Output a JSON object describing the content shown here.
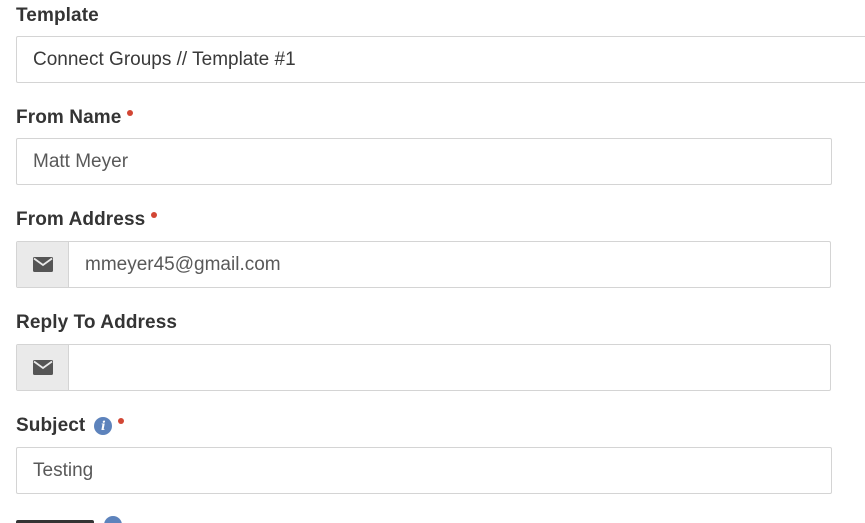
{
  "form": {
    "template": {
      "label": "Template",
      "value": "Connect Groups // Template #1"
    },
    "from_name": {
      "label": "From Name",
      "required": true,
      "value": "Matt Meyer"
    },
    "from_address": {
      "label": "From Address",
      "required": true,
      "icon": "envelope-icon",
      "value": "mmeyer45@gmail.com"
    },
    "reply_to_address": {
      "label": "Reply To Address",
      "icon": "envelope-icon",
      "value": ""
    },
    "subject": {
      "label": "Subject",
      "required": true,
      "info_icon": "info-icon",
      "value": "Testing"
    }
  },
  "colors": {
    "label_text": "#343434",
    "required_dot": "#d24634",
    "info_icon": "#5d83bc",
    "addon_bg": "#eaeaea",
    "border": "#d4d4d4"
  }
}
